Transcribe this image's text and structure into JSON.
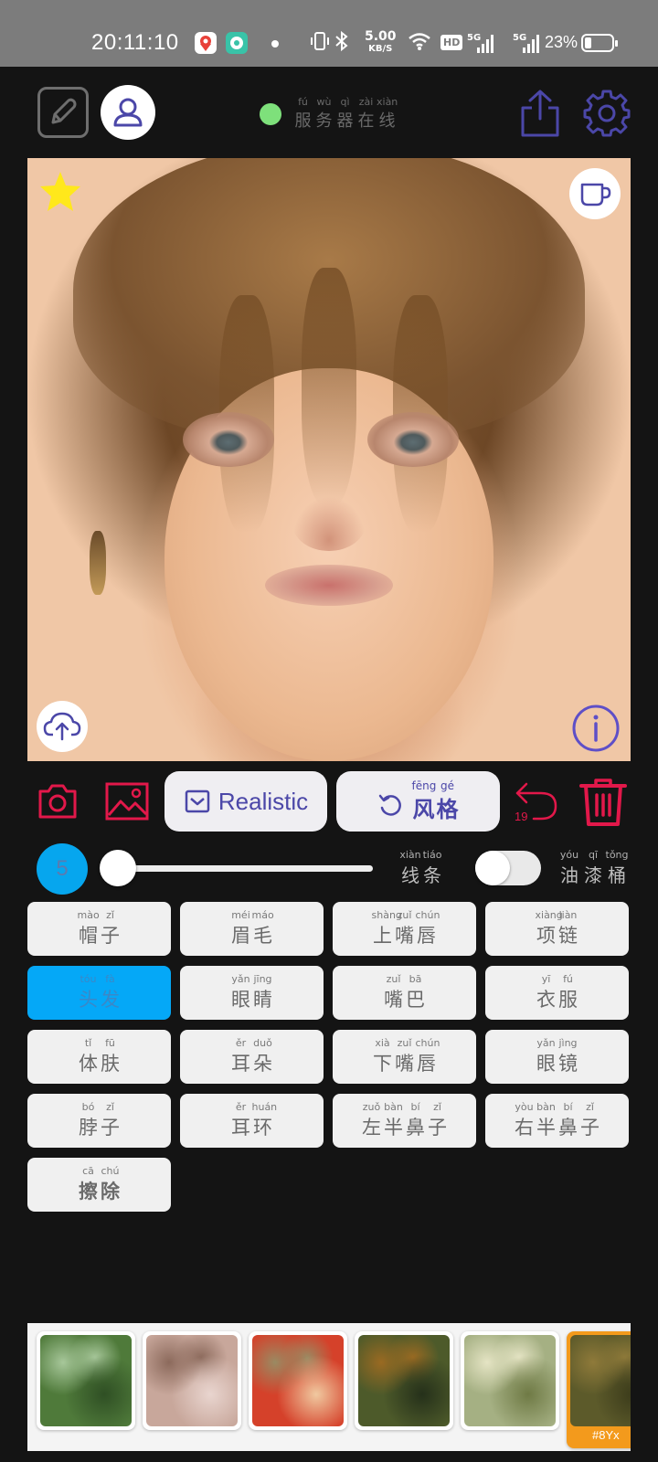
{
  "status_bar": {
    "time": "20:11:10",
    "speed_value": "5.00",
    "speed_unit": "KB/S",
    "hd_badge": "HD",
    "signal_1": "5G",
    "signal_2": "5G",
    "battery_percent": "23%",
    "icons": [
      "map-app-icon",
      "chat-app-icon",
      "vibrate-icon",
      "bluetooth-icon",
      "wifi-icon",
      "signal-icon",
      "battery-icon"
    ]
  },
  "header": {
    "server_status": {
      "pinyin": [
        "fú",
        "wù",
        "qì",
        "zài",
        "xiàn"
      ],
      "hanzi": [
        "服",
        "务",
        "器",
        "在",
        "线"
      ],
      "color": "#7ee07b"
    },
    "icons": [
      "edit-icon",
      "user-icon",
      "share-icon",
      "settings-gear-icon"
    ]
  },
  "image_overlay_icons": [
    "favorite-star-icon",
    "coffee-cup-icon",
    "cloud-upload-icon",
    "info-icon"
  ],
  "toolbar": {
    "realistic_label": "Realistic",
    "style_pinyin": [
      "fēng",
      "gé"
    ],
    "style_hanzi": [
      "风",
      "格"
    ],
    "undo_count": "19",
    "accent_color": "#e2184a",
    "button_text_color": "#4b47a8"
  },
  "brush": {
    "size": "5",
    "level": 0,
    "line_pinyin": [
      "xiàn",
      "tiáo"
    ],
    "line_hanzi": [
      "线",
      "条"
    ],
    "oil_pinyin": [
      "yóu",
      "qī",
      "tǒng"
    ],
    "oil_hanzi": [
      "油",
      "漆",
      "桶"
    ],
    "oil_enabled": false
  },
  "parts": [
    {
      "pinyin": [
        "mào",
        "zǐ"
      ],
      "hanzi": [
        "帽",
        "子"
      ],
      "active": false
    },
    {
      "pinyin": [
        "méi",
        "máo"
      ],
      "hanzi": [
        "眉",
        "毛"
      ],
      "active": false
    },
    {
      "pinyin": [
        "shàng",
        "zuǐ",
        "chún"
      ],
      "hanzi": [
        "上",
        "嘴",
        "唇"
      ],
      "active": false
    },
    {
      "pinyin": [
        "xiàng",
        "liàn"
      ],
      "hanzi": [
        "项",
        "链"
      ],
      "active": false
    },
    {
      "pinyin": [
        "tóu",
        "fà"
      ],
      "hanzi": [
        "头",
        "发"
      ],
      "active": true
    },
    {
      "pinyin": [
        "yǎn",
        "jīng"
      ],
      "hanzi": [
        "眼",
        "睛"
      ],
      "active": false
    },
    {
      "pinyin": [
        "zuǐ",
        "bā"
      ],
      "hanzi": [
        "嘴",
        "巴"
      ],
      "active": false
    },
    {
      "pinyin": [
        "yī",
        "fú"
      ],
      "hanzi": [
        "衣",
        "服"
      ],
      "active": false
    },
    {
      "pinyin": [
        "tǐ",
        "fū"
      ],
      "hanzi": [
        "体",
        "肤"
      ],
      "active": false
    },
    {
      "pinyin": [
        "ěr",
        "duǒ"
      ],
      "hanzi": [
        "耳",
        "朵"
      ],
      "active": false
    },
    {
      "pinyin": [
        "xià",
        "zuǐ",
        "chún"
      ],
      "hanzi": [
        "下",
        "嘴",
        "唇"
      ],
      "active": false
    },
    {
      "pinyin": [
        "yǎn",
        "jìng"
      ],
      "hanzi": [
        "眼",
        "镜"
      ],
      "active": false
    },
    {
      "pinyin": [
        "bó",
        "zǐ"
      ],
      "hanzi": [
        "脖",
        "子"
      ],
      "active": false
    },
    {
      "pinyin": [
        "ěr",
        "huán"
      ],
      "hanzi": [
        "耳",
        "环"
      ],
      "active": false
    },
    {
      "pinyin": [
        "zuǒ",
        "bàn",
        "bí",
        "zǐ"
      ],
      "hanzi": [
        "左",
        "半",
        "鼻",
        "子"
      ],
      "active": false
    },
    {
      "pinyin": [
        "yòu",
        "bàn",
        "bí",
        "zǐ"
      ],
      "hanzi": [
        "右",
        "半",
        "鼻",
        "子"
      ],
      "active": false
    },
    {
      "pinyin": [
        "cā",
        "chú"
      ],
      "hanzi": [
        "擦",
        "除"
      ],
      "active": false,
      "bold": true
    }
  ],
  "thumbnails": [
    {
      "name": "style-thumb-green-foliage",
      "colors": [
        "#4f7a3a",
        "#a7c79a",
        "#2f4f24"
      ]
    },
    {
      "name": "style-thumb-pink-blossom",
      "colors": [
        "#c8a79b",
        "#8c6a5c",
        "#e9d5cf"
      ]
    },
    {
      "name": "style-thumb-red-tree",
      "colors": [
        "#d5412a",
        "#9a8a62",
        "#f0c9a0"
      ]
    },
    {
      "name": "style-thumb-autumn-forest",
      "colors": [
        "#4d5a2a",
        "#9a6a22",
        "#25301a"
      ]
    },
    {
      "name": "style-thumb-mossy-texture",
      "colors": [
        "#a5b083",
        "#e5e4c4",
        "#6f7a45"
      ]
    },
    {
      "name": "style-thumb-selected",
      "colors": [
        "#5c5a2a",
        "#8f7a3a",
        "#3a3a1a"
      ],
      "selected": true,
      "code": "#8Yx"
    }
  ]
}
